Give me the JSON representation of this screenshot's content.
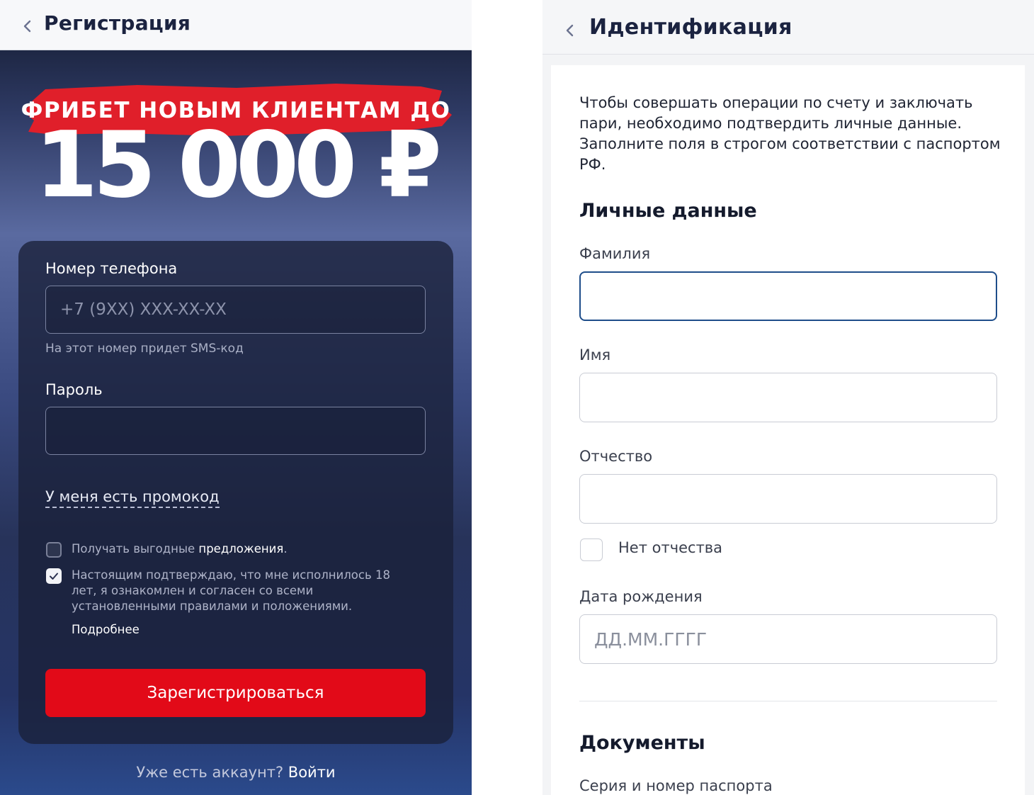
{
  "registration": {
    "title": "Регистрация",
    "promo_line": "ФРИБЕТ НОВЫМ КЛИЕНТАМ ДО",
    "promo_amount": "15 000 ₽",
    "phone_label": "Номер телефона",
    "phone_placeholder": "+7 (9XX) XXX-XX-XX",
    "phone_hint": "На этот номер придет SMS-код",
    "password_label": "Пароль",
    "promo_code_link": "У меня есть промокод",
    "offers_text": "Получать выгодные",
    "offers_link": "предложения",
    "offers_checked": false,
    "consent_text": "Настоящим подтверждаю, что мне исполнилось 18 лет, я ознакомлен и согласен со всеми установленными правилами и положениями.",
    "consent_checked": true,
    "more_link": "Подробнее",
    "register_button": "Зарегистрироваться",
    "footer_question": "Уже есть аккаунт?",
    "footer_login": "Войти"
  },
  "identification": {
    "title": "Идентификация",
    "intro": "Чтобы совершать операции по счету и заключать пари, необходимо подтвердить личные данные. Заполните поля в строгом соответствии с паспортом РФ.",
    "personal_heading": "Личные данные",
    "surname_label": "Фамилия",
    "name_label": "Имя",
    "patronymic_label": "Отчество",
    "no_patronymic_label": "Нет отчества",
    "no_patronymic_checked": false,
    "birthdate_label": "Дата рождения",
    "birthdate_placeholder": "ДД.ММ.ГГГГ",
    "documents_heading": "Документы",
    "passport_label": "Серия и номер паспорта"
  },
  "colors": {
    "accent_red": "#e20a18",
    "focus_blue": "#1e4d8a",
    "dark_navy": "#1b2340"
  },
  "icons": {
    "back": "chevron-left-icon",
    "check": "checkmark-icon"
  }
}
